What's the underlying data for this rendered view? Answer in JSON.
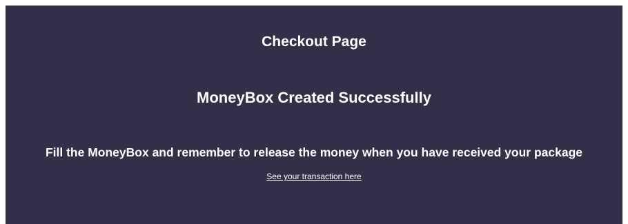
{
  "page": {
    "title": "Checkout Page",
    "status": "MoneyBox Created Successfully",
    "instruction": "Fill the MoneyBox and remember to release the money when you have received your package",
    "transaction_link": "See your transaction here"
  },
  "colors": {
    "background": "#322f49",
    "page_background": "#ffffff",
    "text": "#ffffff"
  }
}
